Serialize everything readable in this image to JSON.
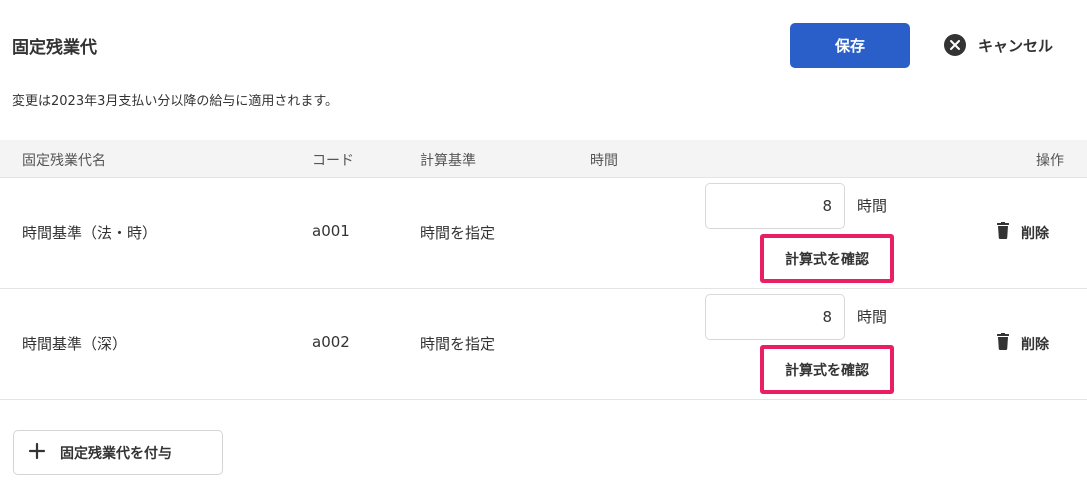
{
  "header": {
    "title": "固定残業代",
    "save_label": "保存",
    "cancel_label": "キャンセル"
  },
  "notice": "変更は2023年3月支払い分以降の給与に適用されます。",
  "table": {
    "columns": {
      "name": "固定残業代名",
      "code": "コード",
      "basis": "計算基準",
      "hours": "時間",
      "actions": "操作"
    },
    "rows": [
      {
        "name": "時間基準（法・時）",
        "code": "a001",
        "basis": "時間を指定",
        "hours": "8",
        "unit": "時間",
        "formula_label": "計算式を確認",
        "delete_label": "削除"
      },
      {
        "name": "時間基準（深）",
        "code": "a002",
        "basis": "時間を指定",
        "hours": "8",
        "unit": "時間",
        "formula_label": "計算式を確認",
        "delete_label": "削除"
      }
    ]
  },
  "add_button_label": "固定残業代を付与",
  "colors": {
    "primary": "#2a5fca",
    "highlight": "#ea1f63",
    "header_bg": "#f5f4f4"
  },
  "icons": {
    "cancel": "close-circle-icon",
    "delete": "trash-icon",
    "add": "plus-icon"
  }
}
